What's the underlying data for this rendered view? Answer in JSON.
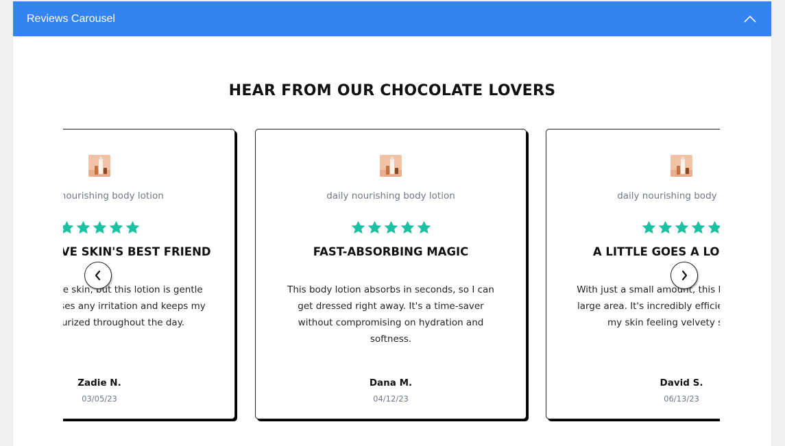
{
  "panel": {
    "title": "Reviews Carousel",
    "collapse_icon": "chevron-up-icon"
  },
  "section": {
    "heading": "HEAR FROM OUR CHOCOLATE LOVERS"
  },
  "colors": {
    "header_bg": "#3384ee",
    "star": "#1ec1a4",
    "muted_text": "#6f7787"
  },
  "navigation": {
    "prev_icon": "chevron-left-icon",
    "next_icon": "chevron-right-icon"
  },
  "reviews": [
    {
      "product": "daily nourishing body lotion",
      "rating": 5,
      "title": "MY SENSITIVE SKIN'S BEST FRIEND",
      "body": "I have sensitive skin, but this lotion is gentle and never causes any irritation and keeps my skin moisturized throughout the day.",
      "reviewer": "Zadie N.",
      "date": "03/05/23"
    },
    {
      "product": "daily nourishing body lotion",
      "rating": 5,
      "title": "FAST-ABSORBING MAGIC",
      "body": "This body lotion absorbs in seconds, so I can get dressed right away. It's a time-saver without compromising on hydration and softness.",
      "reviewer": "Dana M.",
      "date": "04/12/23"
    },
    {
      "product": "daily nourishing body lotion",
      "rating": 5,
      "title": "A LITTLE GOES A LONG WAY",
      "body": "With just a small amount, this lotion covers a large area. It's incredibly efficient and leaves my skin feeling velvety smooth.",
      "reviewer": "David S.",
      "date": "06/13/23"
    }
  ]
}
